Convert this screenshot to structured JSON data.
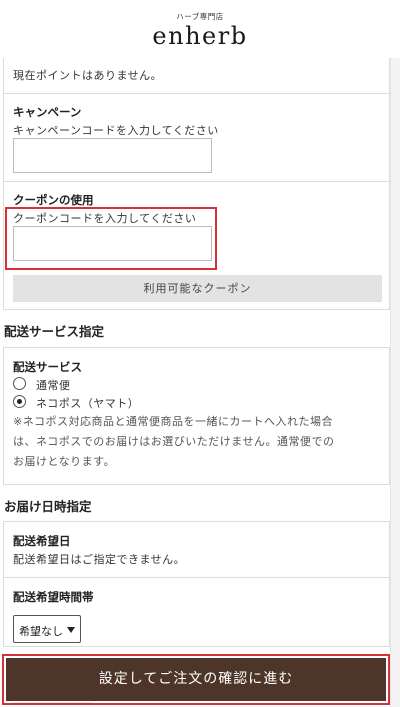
{
  "header": {
    "subtitle": "ハーブ専門店",
    "logo": "enherb"
  },
  "points": {
    "text": "現在ポイントはありません。"
  },
  "campaign": {
    "title": "キャンペーン",
    "placeholder": "キャンペーンコードを入力してください",
    "value": ""
  },
  "coupon": {
    "title": "クーポンの使用",
    "placeholder": "クーポンコードを入力してください",
    "value": "",
    "available_button": "利用可能なクーポン"
  },
  "delivery_service": {
    "section_title": "配送サービス指定",
    "label": "配送サービス",
    "options": [
      {
        "label": "通常便",
        "selected": false
      },
      {
        "label": "ネコポス（ヤマト）",
        "selected": true
      }
    ],
    "note_lines": [
      "※ネコポス対応商品と通常便商品を一緒にカートへ入れた場合",
      "は、ネコポスでのお届けはお選びいただけません。通常便での",
      "お届けとなります。"
    ]
  },
  "delivery_datetime": {
    "section_title": "お届け日時指定",
    "date_label": "配送希望日",
    "date_text": "配送希望日はご指定できません。",
    "time_label": "配送希望時間帯",
    "time_select_value": "希望なし"
  },
  "submit": {
    "label": "設定してご注文の確認に進む"
  },
  "colors": {
    "submit_bg": "#4d3629",
    "highlight_border": "#d5313a",
    "gray_button_bg": "#e3e3e3"
  }
}
